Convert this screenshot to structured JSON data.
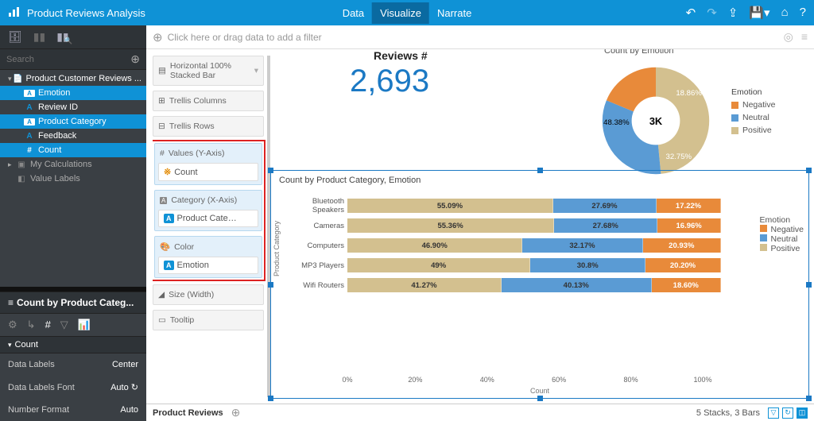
{
  "app": {
    "title": "Product Reviews Analysis"
  },
  "top_tabs": {
    "data": "Data",
    "visualize": "Visualize",
    "narrate": "Narrate"
  },
  "filter": {
    "placeholder": "Click here or drag data to add a filter"
  },
  "search": {
    "placeholder": "Search"
  },
  "tree": {
    "root": "Product Customer Reviews ...",
    "fields": {
      "emotion": "Emotion",
      "review_id": "Review ID",
      "product_category": "Product Category",
      "feedback": "Feedback",
      "count": "Count"
    },
    "my_calc": "My Calculations",
    "value_labels": "Value Labels"
  },
  "selection": {
    "title": "Count by Product Categ...",
    "section": "Count",
    "props": {
      "data_labels_k": "Data Labels",
      "data_labels_v": "Center",
      "font_k": "Data Labels Font",
      "font_v": "Auto",
      "numfmt_k": "Number Format",
      "numfmt_v": "Auto"
    }
  },
  "dropzones": {
    "charttype": "Horizontal 100% Stacked Bar",
    "trellis_cols": "Trellis Columns",
    "trellis_rows": "Trellis Rows",
    "values": "Values (Y-Axis)",
    "values_chip": "Count",
    "category": "Category (X-Axis)",
    "category_chip": "Product Cate…",
    "color": "Color",
    "color_chip": "Emotion",
    "size": "Size (Width)",
    "tooltip": "Tooltip"
  },
  "metric": {
    "title": "Reviews #",
    "value": "2,693"
  },
  "donut": {
    "title": "Count by Emotion",
    "center": "3K",
    "legend_title": "Emotion",
    "legend": {
      "neg": "Negative",
      "neu": "Neutral",
      "pos": "Positive"
    },
    "labels": {
      "neg": "18.86%",
      "neu": "32.75%",
      "pos": "48.38%"
    }
  },
  "chart": {
    "title": "Count by Product Category, Emotion",
    "ylabel": "Product Category",
    "xlabel": "Count",
    "legend_title": "Emotion",
    "legend": {
      "neg": "Negative",
      "neu": "Neutral",
      "pos": "Positive"
    },
    "ticks": [
      "0%",
      "20%",
      "40%",
      "60%",
      "80%",
      "100%"
    ],
    "rows": [
      {
        "label": "Bluetooth Speakers",
        "pos": "55.09%",
        "neu": "27.69%",
        "neg": "17.22%"
      },
      {
        "label": "Cameras",
        "pos": "55.36%",
        "neu": "27.68%",
        "neg": "16.96%"
      },
      {
        "label": "Computers",
        "pos": "46.90%",
        "neu": "32.17%",
        "neg": "20.93%"
      },
      {
        "label": "MP3 Players",
        "pos": "49%",
        "neu": "30.8%",
        "neg": "20.20%"
      },
      {
        "label": "Wifi Routers",
        "pos": "41.27%",
        "neu": "40.13%",
        "neg": "18.60%"
      }
    ]
  },
  "chart_data": [
    {
      "type": "pie",
      "title": "Count by Emotion",
      "series": [
        {
          "name": "Emotion",
          "values": [
            {
              "category": "Positive",
              "value": 48.38
            },
            {
              "category": "Neutral",
              "value": 32.75
            },
            {
              "category": "Negative",
              "value": 18.86
            }
          ]
        }
      ],
      "total_label": "3K"
    },
    {
      "type": "bar",
      "orientation": "horizontal",
      "stacked": "100%",
      "title": "Count by Product Category, Emotion",
      "xlabel": "Count",
      "ylabel": "Product Category",
      "categories": [
        "Bluetooth Speakers",
        "Cameras",
        "Computers",
        "MP3 Players",
        "Wifi Routers"
      ],
      "series": [
        {
          "name": "Positive",
          "values": [
            55.09,
            55.36,
            46.9,
            49.0,
            41.27
          ]
        },
        {
          "name": "Neutral",
          "values": [
            27.69,
            27.68,
            32.17,
            30.8,
            40.13
          ]
        },
        {
          "name": "Negative",
          "values": [
            17.22,
            16.96,
            20.93,
            20.2,
            18.6
          ]
        }
      ],
      "xlim": [
        0,
        100
      ]
    }
  ],
  "footer": {
    "sheet": "Product Reviews",
    "status": "5 Stacks, 3 Bars"
  },
  "colors": {
    "pos": "#d3c08f",
    "neu": "#5a9bd4",
    "neg": "#e88a3a"
  }
}
